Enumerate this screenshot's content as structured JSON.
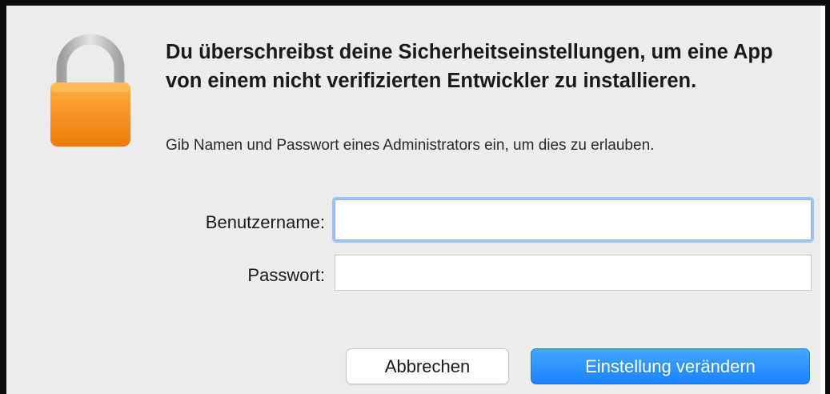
{
  "dialog": {
    "icon": "lock-icon",
    "title": "Du überschreibst deine Sicherheitseinstellungen, um eine App von einem nicht verifizierten Entwickler zu installieren.",
    "message": "Gib Namen und Passwort eines Administrators ein, um dies zu erlauben.",
    "username_label": "Benutzername:",
    "username_value": "",
    "password_label": "Passwort:",
    "password_value": "",
    "cancel_label": "Abbrechen",
    "confirm_label": "Einstellung verändern"
  },
  "colors": {
    "lock_body": "#f7931e",
    "lock_shackle": "#bdbdbd",
    "accent": "#1a82fb",
    "background": "#ececec"
  }
}
